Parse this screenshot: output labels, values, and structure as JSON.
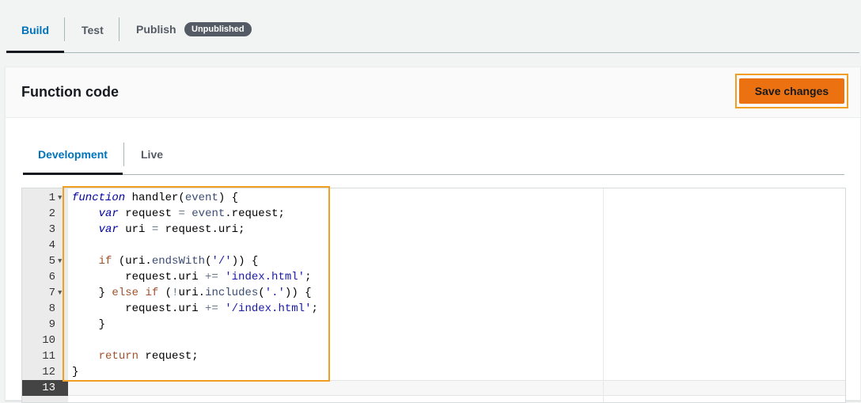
{
  "top_tabs": {
    "build": "Build",
    "test": "Test",
    "publish": "Publish",
    "publish_badge": "Unpublished"
  },
  "panel": {
    "title": "Function code",
    "save_label": "Save changes"
  },
  "inner_tabs": {
    "development": "Development",
    "live": "Live"
  },
  "editor": {
    "line_numbers": [
      "1",
      "2",
      "3",
      "4",
      "5",
      "6",
      "7",
      "8",
      "9",
      "10",
      "11",
      "12",
      "13"
    ],
    "code": [
      "function handler(event) {",
      "    var request = event.request;",
      "    var uri = request.uri;",
      "",
      "    if (uri.endsWith('/')) {",
      "        request.uri += 'index.html';",
      "    } else if (!uri.includes('.')) {",
      "        request.uri += '/index.html';",
      "    }",
      "",
      "    return request;",
      "}",
      ""
    ]
  },
  "colors": {
    "accent": "#0073bb",
    "save_button": "#ec7211",
    "highlight": "#f29e23"
  }
}
